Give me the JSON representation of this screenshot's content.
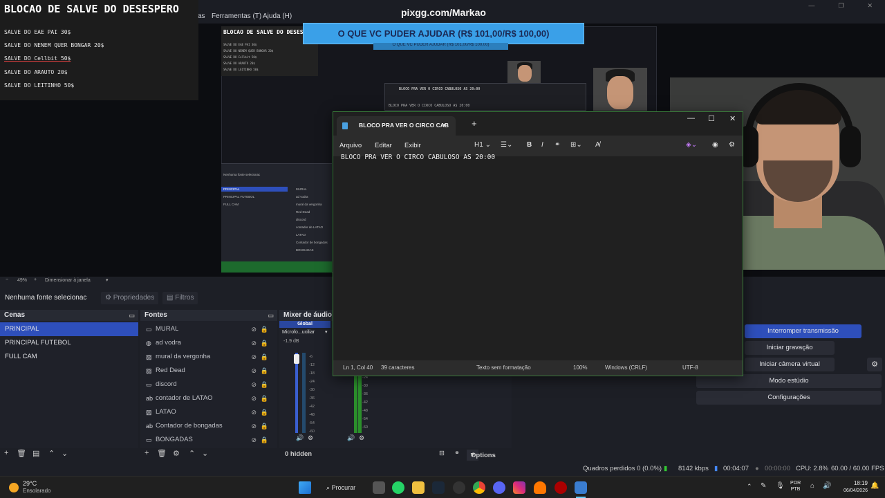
{
  "overlay": {
    "title": "BLOCAO DE SALVE DO DESESPERO",
    "lines": [
      "SALVE DO EAE PAI 30$",
      "SALVE DO NENEM QUER BONGAR 20$",
      "SALVE DO Cellbit 50$",
      "SALVE DO ARAUTO 20$",
      "SALVE DO LEITINHO 50$"
    ],
    "top_title": "pixgg.com/Markao",
    "donation": "O QUE VC PUDER AJUDAR (R$ 101,00/R$ 100,00)"
  },
  "obs": {
    "menu": [
      "as",
      "Ferramentas (T)",
      "Ajuda (H)"
    ],
    "zoom": {
      "value": "49%",
      "mode": "Dimensionar à janela"
    },
    "no_source": "Nenhuma fonte selecionac",
    "properties_label": "Propriedades",
    "filters_label": "Filtros",
    "scenes": {
      "title": "Cenas",
      "items": [
        "PRINCIPAL",
        "PRINCIPAL FUTEBOL",
        "FULL CAM"
      ],
      "active_index": 0
    },
    "sources": {
      "title": "Fontes",
      "items": [
        {
          "label": "MURAL",
          "icon": "window-icon"
        },
        {
          "label": "ad vodra",
          "icon": "browser-icon"
        },
        {
          "label": "mural da vergonha",
          "icon": "image-icon"
        },
        {
          "label": "Red Dead",
          "icon": "image-icon"
        },
        {
          "label": "discord",
          "icon": "window-icon"
        },
        {
          "label": "contador de LATAO",
          "icon": "text-icon"
        },
        {
          "label": "LATAO",
          "icon": "image-icon"
        },
        {
          "label": "Contador de bongadas",
          "icon": "text-icon"
        },
        {
          "label": "BONGADAS",
          "icon": "window-icon"
        }
      ]
    },
    "mixer": {
      "title": "Mixer de áudio",
      "global": "Global",
      "device": "Microfo...uxiliar",
      "db": "-1.9 dB",
      "scale": [
        "-6",
        "-12",
        "-18",
        "-24",
        "-30",
        "-36",
        "-42",
        "-48",
        "-54",
        "-60"
      ],
      "hidden": "0 hidden",
      "options": "Options"
    },
    "controls": {
      "stop_stream": "Interromper transmissão",
      "start_rec": "Iniciar gravação",
      "virtual_cam": "Iniciar câmera virtual",
      "studio": "Modo estúdio",
      "settings": "Configurações"
    },
    "status": {
      "dropped": "Quadros perdidos 0 (0.0%)",
      "kbps": "8142 kbps",
      "stream_time": "00:04:07",
      "rec_time": "00:00:00",
      "cpu": "CPU: 2.8%",
      "fps": "60.00 / 60.00 FPS"
    }
  },
  "notepad": {
    "tab_title": "BLOCO PRA VER O CIRCO CABULOS",
    "menu": [
      "Arquivo",
      "Editar",
      "Exibir"
    ],
    "heading": "H1",
    "content": "BLOCO PRA VER O CIRCO CABULOSO AS 20:00",
    "status": {
      "pos": "Ln 1, Col 40",
      "chars": "39 caracteres",
      "format": "Texto sem formatação",
      "zoom": "100%",
      "eol": "Windows (CRLF)",
      "enc": "UTF-8"
    }
  },
  "inner_notepad": {
    "title": "BLOCO PRA VER O CIRCO CABULOSO AS 20:00",
    "menu": [
      "Arquivo",
      "Editar",
      "Exibir"
    ],
    "tiny_title": "BLOCAO DE SALVE DO DESES"
  },
  "inner_obs": {
    "header": "Nenhuma fonte selecionac",
    "scenes": [
      "PRINCIPAL",
      "PRINCIPAL FUTEBOL",
      "FULL CAM"
    ],
    "sources": [
      "MURAL",
      "ad vodra",
      "mural da vergonha",
      "Red Dead",
      "discord",
      "contador de LATAO",
      "LATAO",
      "Contador de bongadas",
      "BONGADAS"
    ]
  },
  "taskbar": {
    "temp": "29°C",
    "weather": "Ensolarado",
    "search": "Procurar",
    "lang1": "POR",
    "lang2": "PTB",
    "time": "18:19",
    "date": "06/04/2026"
  }
}
